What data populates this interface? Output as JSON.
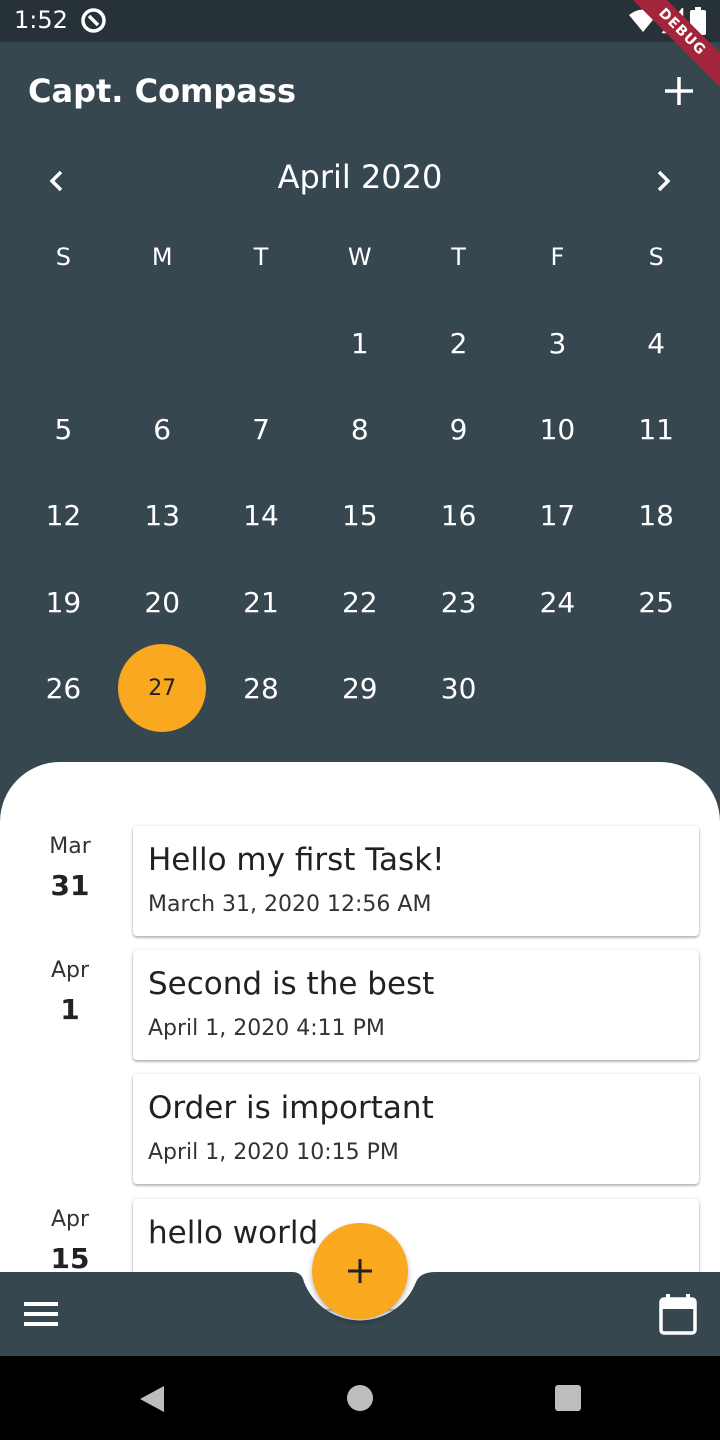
{
  "status": {
    "time": "1:52",
    "debug_label": "DEBUG"
  },
  "header": {
    "title": "Capt. Compass"
  },
  "calendar": {
    "month_label": "April 2020",
    "weekdays": [
      "S",
      "M",
      "T",
      "W",
      "T",
      "F",
      "S"
    ],
    "leading_blanks": 3,
    "days": [
      "1",
      "2",
      "3",
      "4",
      "5",
      "6",
      "7",
      "8",
      "9",
      "10",
      "11",
      "12",
      "13",
      "14",
      "15",
      "16",
      "17",
      "18",
      "19",
      "20",
      "21",
      "22",
      "23",
      "24",
      "25",
      "26",
      "27",
      "28",
      "29",
      "30"
    ],
    "selected_day": "27"
  },
  "tasks": [
    {
      "month": "Mar",
      "day": "31",
      "title": "Hello my first Task!",
      "time": "March 31, 2020 12:56 AM"
    },
    {
      "month": "Apr",
      "day": "1",
      "title": "Second is the best",
      "time": "April 1, 2020 4:11 PM"
    },
    {
      "month": "",
      "day": "",
      "title": "Order is important",
      "time": "April 1, 2020 10:15 PM"
    },
    {
      "month": "Apr",
      "day": "15",
      "title": "hello world",
      "time": ""
    }
  ],
  "colors": {
    "primary": "#37474f",
    "accent": "#f9a81f",
    "status_bar": "#263238",
    "debug": "#a3253c"
  },
  "icons": {
    "add_top": "plus-icon",
    "prev": "chevron-left-icon",
    "next": "chevron-right-icon",
    "fab": "plus-icon",
    "menu": "menu-icon",
    "calendar": "calendar-icon"
  }
}
